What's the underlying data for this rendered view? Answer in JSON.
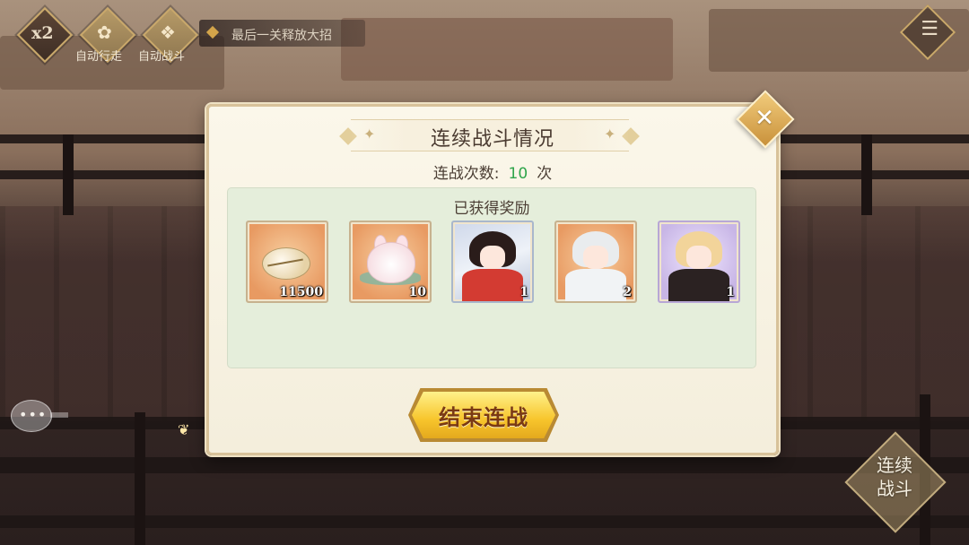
{
  "hud": {
    "speed_label": "x2",
    "auto_move_label": "自动行走",
    "auto_battle_label": "自动战斗",
    "hint": "最后一关释放大招",
    "continuous_battle_label": "连续战斗"
  },
  "dialog": {
    "title": "连续战斗情况",
    "battle_count_label": "连战次数:",
    "battle_count_value": "10",
    "battle_count_unit": "次",
    "rewards_title": "已获得奖励",
    "rewards": [
      {
        "icon": "shell-currency-icon",
        "quantity": "11500",
        "frame": "orange"
      },
      {
        "icon": "bunny-item-icon",
        "quantity": "10",
        "frame": "orange"
      },
      {
        "icon": "character-card-dark-hair",
        "quantity": "1",
        "frame": "blue"
      },
      {
        "icon": "character-card-white-hair",
        "quantity": "2",
        "frame": "orange"
      },
      {
        "icon": "character-card-blonde-hair",
        "quantity": "1",
        "frame": "purple"
      }
    ],
    "end_button_label": "结束连战"
  },
  "colors": {
    "count_value": "#2fa54b",
    "button_gold": "#f7c52c",
    "panel_green": "#e5eedb"
  }
}
